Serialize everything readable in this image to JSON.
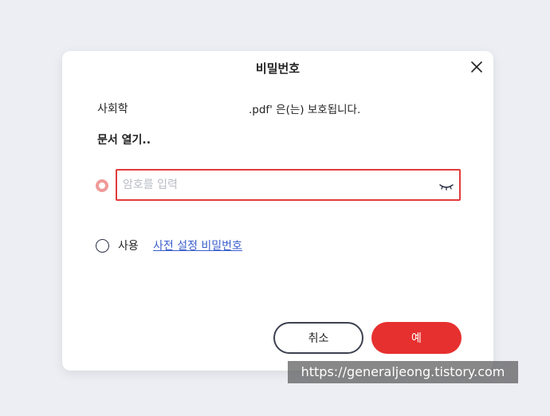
{
  "dialog": {
    "title": "비밀번호",
    "filename": "사회학",
    "protected_message": ".pdf' 은(는) 보호됩니다.",
    "open_label": "문서 열기..",
    "password": {
      "value": "",
      "placeholder": "암호를 입력",
      "selected": true
    },
    "preset": {
      "use_label": "사용",
      "link_label": "사전 설정 비밀번호",
      "selected": false
    },
    "buttons": {
      "cancel_label": "취소",
      "ok_label": "예"
    }
  },
  "watermark": {
    "text": "https://generaljeong.tistory.com"
  },
  "icons": {
    "close": "close-icon",
    "eye": "eye-closed-icon"
  },
  "colors": {
    "accent": "#e6302f",
    "border_active": "#e23b3b",
    "radio_selected": "#f09a9a",
    "link": "#3a5fcb",
    "background": "#eceef3"
  }
}
